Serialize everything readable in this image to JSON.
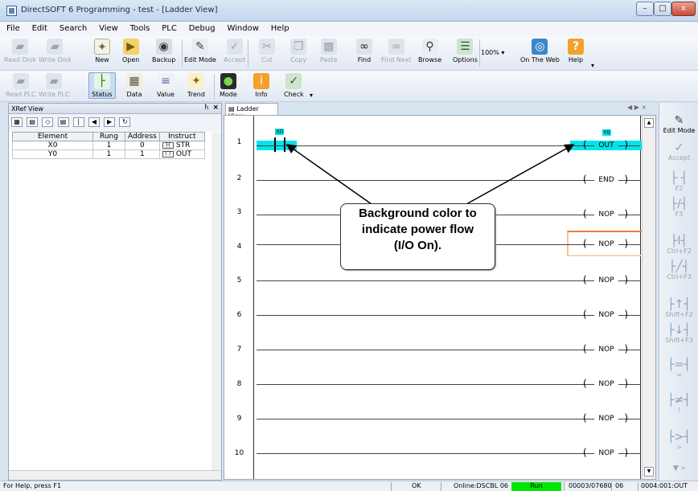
{
  "window": {
    "title": "DirectSOFT 6 Programming - test - [Ladder View]",
    "min": "–",
    "max": "□",
    "close": "x"
  },
  "menu": [
    "File",
    "Edit",
    "Search",
    "View",
    "Tools",
    "PLC",
    "Debug",
    "Window",
    "Help"
  ],
  "toolbar1": {
    "read_disk": "Read Disk",
    "write_disk": "Write Disk",
    "new": "New",
    "open": "Open",
    "backup": "Backup",
    "edit_mode": "Edit Mode",
    "accept": "Accept",
    "cut": "Cut",
    "copy": "Copy",
    "paste": "Paste",
    "find": "Find",
    "find_next": "Find Next",
    "browse": "Browse",
    "options": "Options",
    "zoom": "100%",
    "on_the_web": "On The Web",
    "help": "Help"
  },
  "toolbar2": {
    "read_plc": "Read PLC",
    "write_plc": "Write PLC",
    "status": "Status",
    "data": "Data",
    "value": "Value",
    "trend": "Trend",
    "mode": "Mode",
    "info": "Info",
    "check": "Check"
  },
  "xref": {
    "title": "XRef View",
    "columns": [
      "Element",
      "Rung",
      "Address",
      "Instruct"
    ],
    "rows": [
      {
        "element": "X0",
        "rung": "1",
        "address": "0",
        "instr": "STR"
      },
      {
        "element": "Y0",
        "rung": "1",
        "address": "1",
        "instr": "OUT"
      }
    ]
  },
  "ladder": {
    "tab": "Ladder View",
    "rungs": [
      {
        "num": "1",
        "coil": "OUT",
        "contact": "X0",
        "coil_addr": "Y0"
      },
      {
        "num": "2",
        "coil": "END"
      },
      {
        "num": "3",
        "coil": "NOP"
      },
      {
        "num": "4",
        "coil": "NOP"
      },
      {
        "num": "5",
        "coil": "NOP"
      },
      {
        "num": "6",
        "coil": "NOP"
      },
      {
        "num": "7",
        "coil": "NOP"
      },
      {
        "num": "8",
        "coil": "NOP"
      },
      {
        "num": "9",
        "coil": "NOP"
      },
      {
        "num": "10",
        "coil": "NOP"
      }
    ],
    "power_flow_color": "#00e5ea"
  },
  "callout": {
    "line1": "Background color to",
    "line2": "indicate power flow",
    "line3": "(I/O On)."
  },
  "rightbar": {
    "edit_mode": "Edit Mode",
    "accept": "Accept",
    "f2": "F2",
    "f3": "F3",
    "ctrl_f2": "Ctrl+F2",
    "ctrl_f3": "Ctrl+F3",
    "shift_f2": "Shift+F2",
    "shift_f3": "Shift+F3",
    "eq": "=",
    "ne": "!",
    "gt": ">"
  },
  "status": {
    "help": "For Help, press F1",
    "ok": "OK",
    "online": "Online:DSCBL 06",
    "run": "Run",
    "steps": "00003/07680",
    "cpu": "06",
    "addr": "0004:001:OUT"
  }
}
